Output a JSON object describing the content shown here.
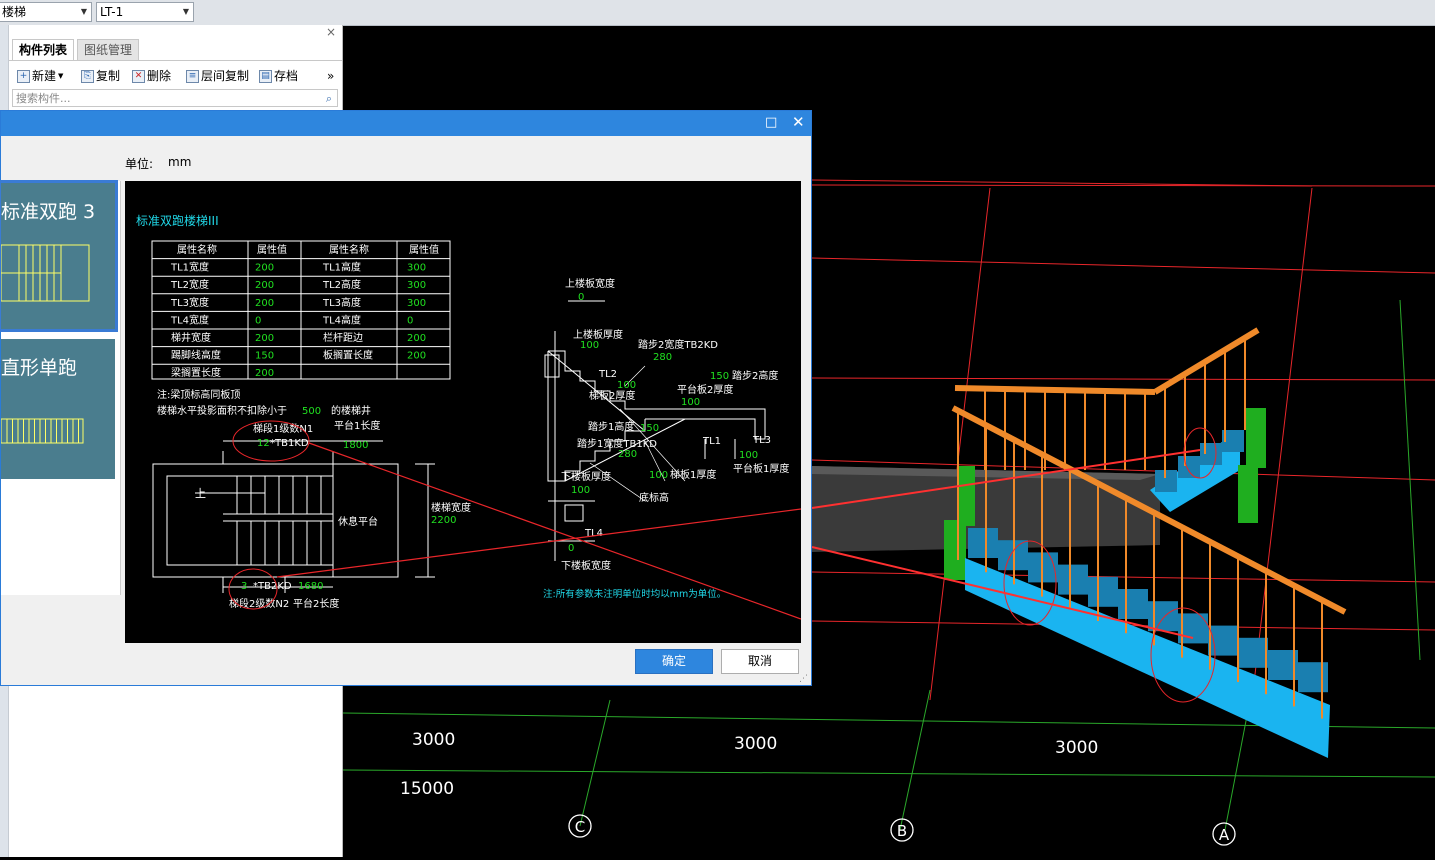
{
  "topbar": {
    "combo1": "楼梯",
    "combo2": "LT-1"
  },
  "panel": {
    "tab_components": "构件列表",
    "tab_drawings": "图纸管理",
    "close": "×",
    "toolbar": {
      "new": "新建",
      "copy": "复制",
      "delete": "删除",
      "floor_copy": "层间复制",
      "archive": "存档",
      "more": "»"
    },
    "search_placeholder": "搜索构件..."
  },
  "dialog": {
    "unit_label": "单位:",
    "unit_value": "mm",
    "ok": "确定",
    "cancel": "取消",
    "thumbs": [
      {
        "label": "标准双跑 3"
      },
      {
        "label": "直形单跑"
      }
    ],
    "cad": {
      "title": "标准双跑楼梯III",
      "table_headers": [
        "属性名称",
        "属性值",
        "属性名称",
        "属性值"
      ],
      "rows": [
        [
          "TL1宽度",
          "200",
          "TL1高度",
          "300"
        ],
        [
          "TL2宽度",
          "200",
          "TL2高度",
          "300"
        ],
        [
          "TL3宽度",
          "200",
          "TL3高度",
          "300"
        ],
        [
          "TL4宽度",
          "0",
          "TL4高度",
          "0"
        ],
        [
          "梯井宽度",
          "200",
          "栏杆距边",
          "200"
        ],
        [
          "踢脚线高度",
          "150",
          "板搁置长度",
          "200"
        ],
        [
          "梁搁置长度",
          "200",
          "",
          ""
        ]
      ],
      "note1": "注:梁顶标高同板顶",
      "note2_a": "楼梯水平投影面积不扣除小于",
      "note2_val": "500",
      "note2_b": "的楼梯井",
      "seg1_label": "梯段1级数N1",
      "seg1_val": "12",
      "seg1_kd": "*TB1KD",
      "plat1_label": "平台1长度",
      "plat1_val": "1800",
      "up": "上",
      "rest": "休息平台",
      "width_label": "楼梯宽度",
      "width_val": "2200",
      "seg2_val": "3",
      "seg2_kd": "*TB2KD",
      "plat2_val": "1680",
      "seg2_label": "梯段2级数N2",
      "plat2_label": "平台2长度",
      "sec_top_width": "上楼板宽度",
      "sec_top_width_val": "0",
      "sec_top_thick": "上楼板厚度",
      "sec_top_thick_val": "100",
      "step2_width": "踏步2宽度TB2KD",
      "step2_width_val": "280",
      "tl2": "TL2",
      "step2_height_val": "150",
      "step2_height": "踏步2高度",
      "slab2_val": "100",
      "slab2": "梯板2厚度",
      "plat2_thick": "平台板2厚度",
      "plat2_thick_val": "100",
      "step1_height": "踏步1高度",
      "step1_height_val": "150",
      "step1_width": "踏步1宽度TB1KD",
      "step1_width_val": "280",
      "tl1": "TL1",
      "tl3": "TL3",
      "plat1_thick_val": "100",
      "plat1_thick": "平台板1厚度",
      "slab1_val": "100",
      "slab1": "梯板1厚度",
      "bot_thick": "下楼板厚度",
      "bot_thick_val": "100",
      "bottom_elev": "底标高",
      "tl4": "TL4",
      "bot_width_val": "0",
      "bot_width": "下楼板宽度",
      "footnote": "注:所有参数未注明单位时均以mm为单位。"
    }
  },
  "viewport": {
    "dims": [
      "3000",
      "3000",
      "3000"
    ],
    "total": "15000",
    "axes": [
      "C",
      "B",
      "A"
    ]
  },
  "colors": {
    "grid_red": "#e8262a",
    "grid_green": "#2aa82a",
    "stair_blue": "#1ab4f0",
    "rail_orange": "#f08a2a",
    "beam_green": "#1fae1f",
    "cad_green": "#20e020",
    "cad_cyan": "#20d8e8"
  }
}
